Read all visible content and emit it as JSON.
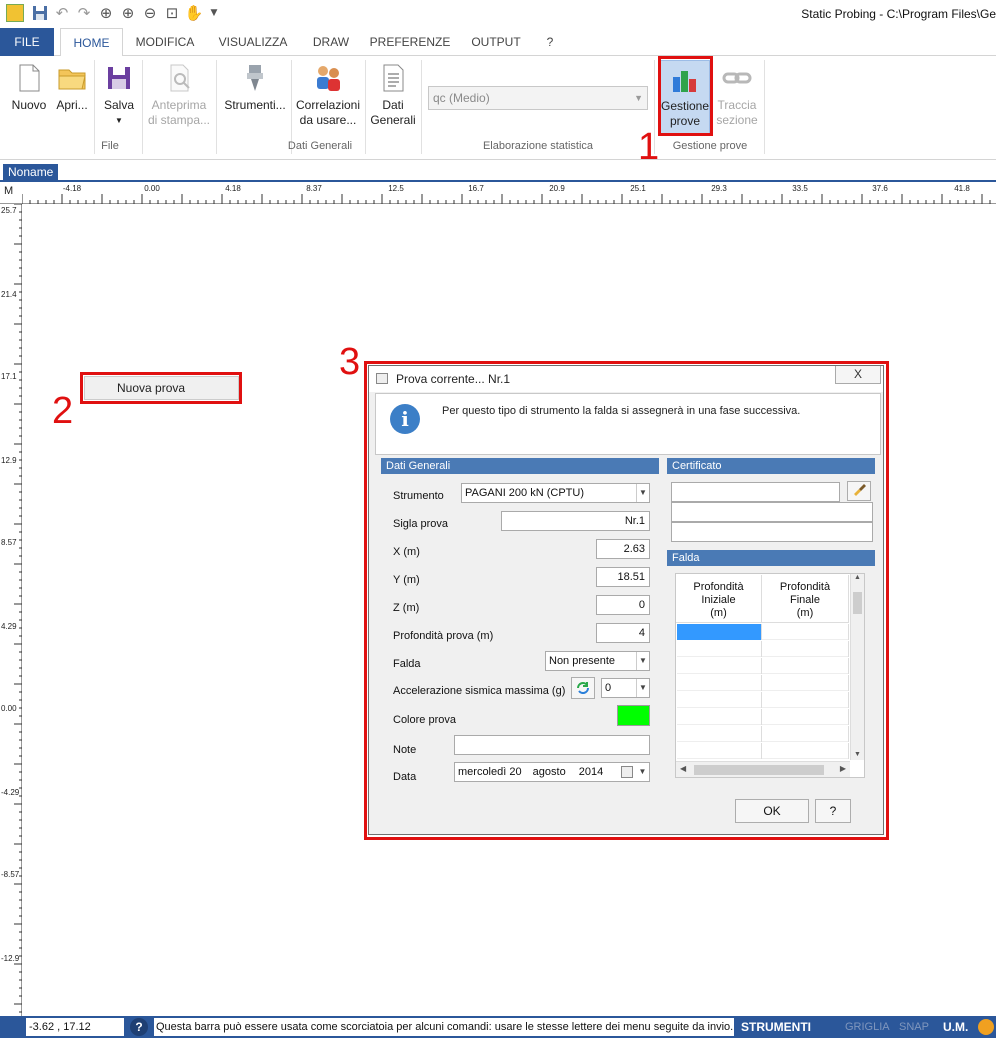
{
  "window": {
    "title": "Static Probing - C:\\Program Files\\Ge"
  },
  "quick_access": [
    "app-icon",
    "save-icon",
    "undo-icon",
    "redo-icon",
    "zoom-fit-icon",
    "zoom-in-icon",
    "zoom-out-icon",
    "zoom-window-icon",
    "pan-hand-icon",
    "dropdown-icon"
  ],
  "tabs": {
    "file": "FILE",
    "home": "HOME",
    "modifica": "MODIFICA",
    "visualizza": "VISUALIZZA",
    "draw": "DRAW",
    "preferenze": "PREFERENZE",
    "output": "OUTPUT",
    "help": "?"
  },
  "ribbon": {
    "nuovo": "Nuovo",
    "apri": "Apri...",
    "salva": "Salva",
    "anteprima": [
      "Anteprima",
      "di stampa..."
    ],
    "strumenti": "Strumenti...",
    "correlazioni": [
      "Correlazioni",
      "da usare..."
    ],
    "dati": [
      "Dati",
      "Generali"
    ],
    "combo_value": "qc (Medio)",
    "gestione": [
      "Gestione",
      "prove"
    ],
    "traccia": [
      "Traccia",
      "sezione"
    ],
    "groups": {
      "file": "File",
      "dati_generali": "Dati Generali",
      "elaborazione": "Elaborazione statistica",
      "gestione": "Gestione prove"
    }
  },
  "annotations": {
    "n1": "1",
    "n2": "2",
    "n3": "3"
  },
  "document_tab": "Noname",
  "ruler": {
    "corner": "M",
    "h_labels": [
      "-4.18",
      "0.00",
      "4.18",
      "8.37",
      "12.5",
      "16.7",
      "20.9",
      "25.1",
      "29.3",
      "33.5",
      "37.6",
      "41.8"
    ],
    "v_labels": [
      "25.7",
      "21.4",
      "17.1",
      "12.9",
      "8.57",
      "4.29",
      "0.00",
      "-4.29",
      "-8.57",
      "-12.9"
    ]
  },
  "context_menu": {
    "item": "Nuova prova"
  },
  "dialog": {
    "title": "Prova corrente... Nr.1",
    "close": "X",
    "info": "Per questo tipo di strumento la falda si assegnerà in una fase successiva.",
    "sections": {
      "dati_generali": "Dati Generali",
      "certificato": "Certificato",
      "falda": "Falda"
    },
    "fields": {
      "strumento_label": "Strumento",
      "strumento_value": "PAGANI 200 kN (CPTU)",
      "sigla_label": "Sigla prova",
      "sigla_value": "Nr.1",
      "x_label": "X (m)",
      "x_value": "2.63",
      "y_label": "Y (m)",
      "y_value": "18.51",
      "z_label": "Z (m)",
      "z_value": "0",
      "prof_label": "Profondità prova (m)",
      "prof_value": "4",
      "falda_label": "Falda",
      "falda_value": "Non presente",
      "acc_label": "Accelerazione sismica massima (g)",
      "acc_value": "0",
      "colore_label": "Colore prova",
      "colore_value": "#00ff00",
      "note_label": "Note",
      "note_value": "",
      "data_label": "Data",
      "data_day": "mercoledì 20",
      "data_month": "agosto",
      "data_year": "2014"
    },
    "falda_table": {
      "col1": [
        "Profondità",
        "Iniziale",
        "(m)"
      ],
      "col2": [
        "Profondità",
        "Finale",
        "(m)"
      ]
    },
    "ok": "OK",
    "help": "?"
  },
  "statusbar": {
    "coords": "-3.62 , 17.12",
    "help": "?",
    "message": "Questa barra può essere usata come scorciatoia per alcuni comandi: usare le stesse lettere dei menu seguite da invio.",
    "strumenti": "STRUMENTI",
    "griglia": "GRIGLIA",
    "snap": "SNAP",
    "um": "U.M."
  },
  "colors": {
    "accent": "#2b579a",
    "annotation": "#e01010",
    "section_header": "#4a7ab5",
    "selection": "#3399ff"
  }
}
